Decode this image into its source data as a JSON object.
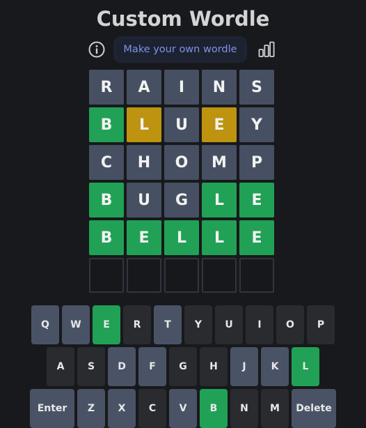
{
  "header": {
    "title": "Custom Wordle",
    "make_button": "Make your own wordle",
    "info_icon": "info-icon",
    "stats_icon": "stats-bar-chart-icon"
  },
  "board": {
    "rows": [
      [
        {
          "letter": "R",
          "state": "absent"
        },
        {
          "letter": "A",
          "state": "absent"
        },
        {
          "letter": "I",
          "state": "absent"
        },
        {
          "letter": "N",
          "state": "absent"
        },
        {
          "letter": "S",
          "state": "absent"
        }
      ],
      [
        {
          "letter": "B",
          "state": "correct"
        },
        {
          "letter": "L",
          "state": "present"
        },
        {
          "letter": "U",
          "state": "absent"
        },
        {
          "letter": "E",
          "state": "present"
        },
        {
          "letter": "Y",
          "state": "absent"
        }
      ],
      [
        {
          "letter": "C",
          "state": "absent"
        },
        {
          "letter": "H",
          "state": "absent"
        },
        {
          "letter": "O",
          "state": "absent"
        },
        {
          "letter": "M",
          "state": "absent"
        },
        {
          "letter": "P",
          "state": "absent"
        }
      ],
      [
        {
          "letter": "B",
          "state": "correct"
        },
        {
          "letter": "U",
          "state": "absent"
        },
        {
          "letter": "G",
          "state": "absent"
        },
        {
          "letter": "L",
          "state": "correct"
        },
        {
          "letter": "E",
          "state": "correct"
        }
      ],
      [
        {
          "letter": "B",
          "state": "correct"
        },
        {
          "letter": "E",
          "state": "correct"
        },
        {
          "letter": "L",
          "state": "correct"
        },
        {
          "letter": "L",
          "state": "correct"
        },
        {
          "letter": "E",
          "state": "correct"
        }
      ],
      [
        {
          "letter": "",
          "state": "empty"
        },
        {
          "letter": "",
          "state": "empty"
        },
        {
          "letter": "",
          "state": "empty"
        },
        {
          "letter": "",
          "state": "empty"
        },
        {
          "letter": "",
          "state": "empty"
        }
      ]
    ]
  },
  "keyboard": {
    "rows": [
      [
        {
          "label": "Q",
          "state": "absent"
        },
        {
          "label": "W",
          "state": "absent"
        },
        {
          "label": "E",
          "state": "correct"
        },
        {
          "label": "R",
          "state": "default"
        },
        {
          "label": "T",
          "state": "absent"
        },
        {
          "label": "Y",
          "state": "default"
        },
        {
          "label": "U",
          "state": "default"
        },
        {
          "label": "I",
          "state": "default"
        },
        {
          "label": "O",
          "state": "default"
        },
        {
          "label": "P",
          "state": "default"
        }
      ],
      [
        {
          "label": "A",
          "state": "default"
        },
        {
          "label": "S",
          "state": "default"
        },
        {
          "label": "D",
          "state": "absent"
        },
        {
          "label": "F",
          "state": "absent"
        },
        {
          "label": "G",
          "state": "default"
        },
        {
          "label": "H",
          "state": "default"
        },
        {
          "label": "J",
          "state": "absent"
        },
        {
          "label": "K",
          "state": "absent"
        },
        {
          "label": "L",
          "state": "correct"
        }
      ],
      [
        {
          "label": "Enter",
          "state": "absent",
          "wide": true
        },
        {
          "label": "Z",
          "state": "absent"
        },
        {
          "label": "X",
          "state": "absent"
        },
        {
          "label": "C",
          "state": "default"
        },
        {
          "label": "V",
          "state": "absent"
        },
        {
          "label": "B",
          "state": "correct"
        },
        {
          "label": "N",
          "state": "default"
        },
        {
          "label": "M",
          "state": "default"
        },
        {
          "label": "Delete",
          "state": "absent",
          "wide": true
        }
      ]
    ]
  },
  "colors": {
    "background": "#18191c",
    "correct": "#21a155",
    "present": "#bd930f",
    "absent_tile": "#475062",
    "absent_key": "#4a5366",
    "default_key": "#2a2b2e",
    "accent": "#7c93e8"
  }
}
